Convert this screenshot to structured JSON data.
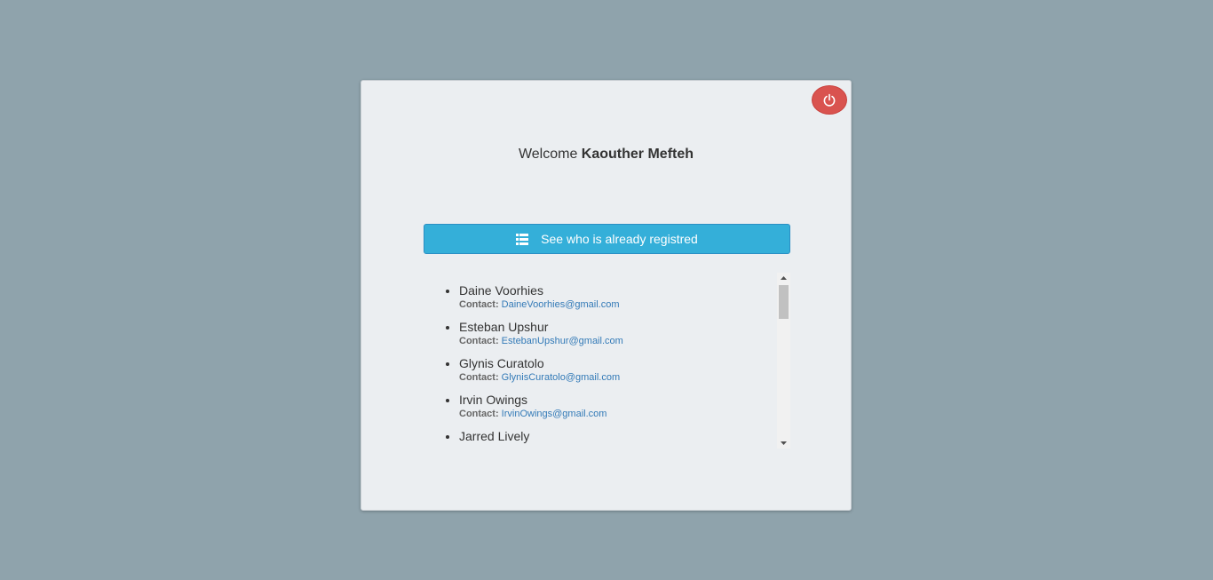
{
  "welcome": {
    "prefix": "Welcome",
    "user_name": "Kaouther Mefteh"
  },
  "actions": {
    "logout_icon": "power-icon",
    "registered_button_label": "See who is already registred",
    "registered_button_icon": "list-icon"
  },
  "colors": {
    "background": "#8fa3ac",
    "card": "#ebeef1",
    "logout_button": "#d9534f",
    "primary_button": "#34afd9",
    "link": "#337ab7"
  },
  "registered": {
    "contact_label": "Contact:",
    "users": [
      {
        "name": "Daine Voorhies",
        "email": "DaineVoorhies@gmail.com"
      },
      {
        "name": "Esteban Upshur",
        "email": "EstebanUpshur@gmail.com"
      },
      {
        "name": "Glynis Curatolo",
        "email": "GlynisCuratolo@gmail.com"
      },
      {
        "name": "Irvin Owings",
        "email": "IrvinOwings@gmail.com"
      },
      {
        "name": "Jarred Lively",
        "email": ""
      }
    ]
  }
}
